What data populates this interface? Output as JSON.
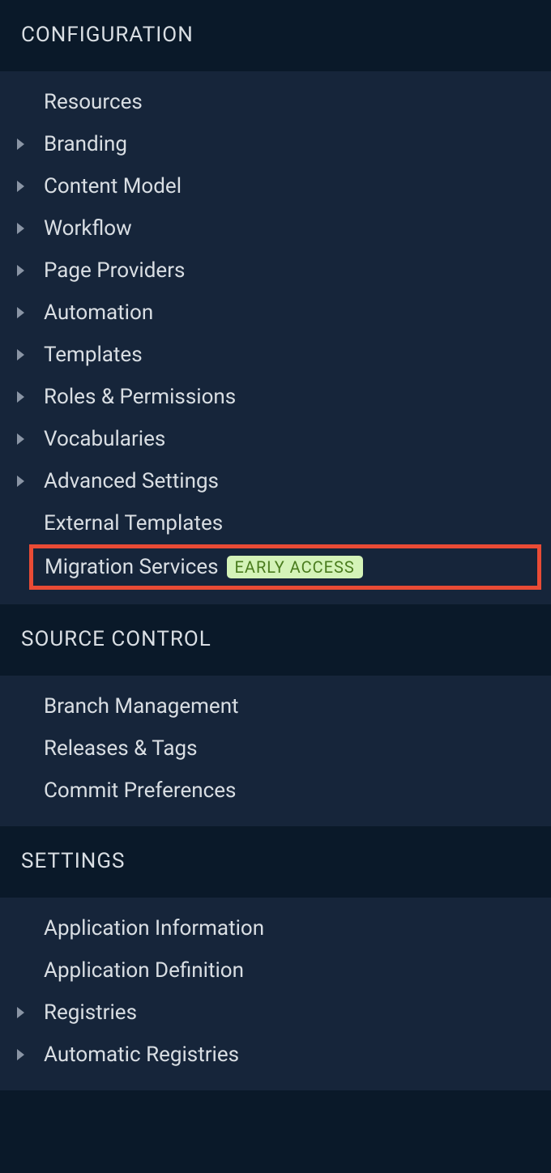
{
  "sections": [
    {
      "title": "CONFIGURATION",
      "items": [
        {
          "label": "Resources",
          "expandable": false
        },
        {
          "label": "Branding",
          "expandable": true
        },
        {
          "label": "Content Model",
          "expandable": true
        },
        {
          "label": "Workflow",
          "expandable": true
        },
        {
          "label": "Page Providers",
          "expandable": true
        },
        {
          "label": "Automation",
          "expandable": true
        },
        {
          "label": "Templates",
          "expandable": true
        },
        {
          "label": "Roles & Permissions",
          "expandable": true
        },
        {
          "label": "Vocabularies",
          "expandable": true
        },
        {
          "label": "Advanced Settings",
          "expandable": true
        },
        {
          "label": "External Templates",
          "expandable": false
        },
        {
          "label": "Migration Services",
          "expandable": false,
          "badge": "EARLY ACCESS",
          "highlighted": true
        }
      ]
    },
    {
      "title": "SOURCE CONTROL",
      "items": [
        {
          "label": "Branch Management",
          "expandable": false
        },
        {
          "label": "Releases & Tags",
          "expandable": false
        },
        {
          "label": "Commit Preferences",
          "expandable": false
        }
      ]
    },
    {
      "title": "SETTINGS",
      "items": [
        {
          "label": "Application Information",
          "expandable": false
        },
        {
          "label": "Application Definition",
          "expandable": false
        },
        {
          "label": "Registries",
          "expandable": true
        },
        {
          "label": "Automatic Registries",
          "expandable": true
        }
      ]
    }
  ]
}
